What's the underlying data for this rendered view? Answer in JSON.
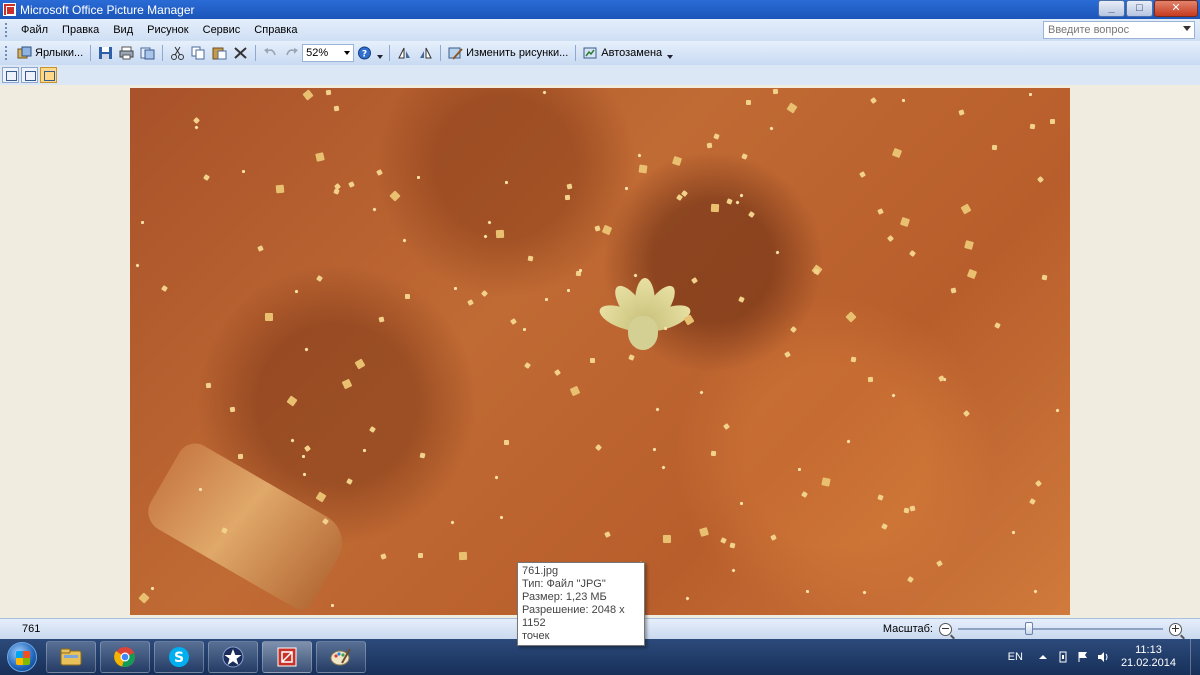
{
  "window": {
    "title": "Microsoft Office Picture Manager",
    "buttons": {
      "minimize": "_",
      "maximize": "□",
      "close": "✕"
    }
  },
  "menu": {
    "items": [
      "Файл",
      "Правка",
      "Вид",
      "Рисунок",
      "Сервис",
      "Справка"
    ],
    "help_placeholder": "Введите вопрос"
  },
  "toolbar": {
    "shortcuts_label": "Ярлыки...",
    "zoom_value": "52%",
    "edit_pictures_label": "Изменить рисунки...",
    "autofix_label": "Автозамена"
  },
  "image": {
    "name": "761"
  },
  "tooltip": {
    "filename": "761.jpg",
    "type": "Тип: Файл \"JPG\"",
    "size": "Размер: 1,23 МБ",
    "resolution": "Разрешение: 2048 x 1152",
    "resolution_unit": "точек"
  },
  "statusbar": {
    "current_name": "761",
    "zoom_label": "Масштаб:",
    "zoom_slider_fraction": 0.34
  },
  "taskbar": {
    "apps": [
      "explorer",
      "chrome",
      "skype",
      "star-app",
      "picture-manager",
      "paint"
    ],
    "active_app": "picture-manager",
    "language": "EN",
    "time": "11:13",
    "date": "21.02.2014"
  },
  "colors": {
    "titlebar": "#1c55b9",
    "menubar": "#cfdff4",
    "workspace": "#f0ede0",
    "soil": "#b85e2c",
    "taskbar": "#17305a"
  }
}
